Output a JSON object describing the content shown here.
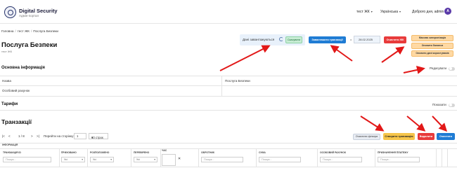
{
  "app": {
    "title": "Digital Security",
    "subtitle": "Адмін-портал"
  },
  "header": {
    "selected_zhk": "тест ЖК",
    "language": "Українська",
    "greeting": "Доброго дня, admin",
    "avatar_letter": "A"
  },
  "breadcrumb": [
    "Головна",
    "тест ЖК",
    "Послуга Безпеки"
  ],
  "page": {
    "title": "Послуга Безпеки",
    "subtitle": "тест ЖК"
  },
  "loading": {
    "text": "Дані завантажуються",
    "cancel_label": "Скасувати"
  },
  "toolbar": {
    "load_transactions_label": "Завантажити транзакції",
    "from_label": "з",
    "date_value": "28.02.2025",
    "clear_zhk_label": "Очистити ЖК"
  },
  "mass_actions": {
    "mass_sync_label": "Масова синхронізація",
    "update_balances_label": "Оновити баланси",
    "update_users_label": "Оновити дані користувачів"
  },
  "basic_info": {
    "title": "Основна інформація",
    "edit_label": "Редагувати",
    "edit_toggle_on": false,
    "rows": [
      {
        "label": "Назва",
        "value": "Послуга Безпеки"
      },
      {
        "label": "Особовий рахунок",
        "value": ""
      }
    ]
  },
  "tariffs": {
    "title": "Тарифи",
    "show_label": "Показати",
    "show_toggle_on": false
  },
  "transactions": {
    "title": "Транзакції",
    "pager": {
      "first": "|<",
      "prev": "<",
      "page_display": "1 / 8",
      "next": ">",
      "last": ">|",
      "goto_label": "Перейти на сторінку:",
      "goto_value": "1",
      "page_size": "10 строк"
    },
    "reset_filters_label": "Очистити фільтри",
    "create_label": "Створити транзакцію",
    "delete_label": "Видалити",
    "clear_label": "Очистити",
    "group_header": "ІНФОРМАЦІЯ",
    "columns": [
      {
        "label": "ТРАНЗАКЦІЯ ID",
        "filter": "Пошук...",
        "kind": "input"
      },
      {
        "label": "ПРИХОВАНО",
        "filter": "Усі",
        "kind": "select"
      },
      {
        "label": "РОЗПОЛОЖЕНО",
        "filter": "Усі",
        "kind": "select"
      },
      {
        "label": "ПЕРЕВІРЕНО",
        "filter": "Усі",
        "kind": "select"
      },
      {
        "label": "ЧАС",
        "filter": "",
        "kind": "date"
      },
      {
        "label": "ОБРОТНИК",
        "filter": "Пошук...",
        "kind": "input"
      },
      {
        "label": "СУМА",
        "filter": "Пошук...",
        "kind": "input"
      },
      {
        "label": "ОСОБОВИЙ РАХУНОК",
        "filter": "Пошук...",
        "kind": "input"
      },
      {
        "label": "ПРИЗНАЧЕННЯ ПЛАТЕЖУ",
        "filter": "Пошук...",
        "kind": "input"
      }
    ]
  },
  "colors": {
    "primary_blue": "#1f7cd4",
    "danger_red": "#e83b3b",
    "warning_yellow": "#f6c54a",
    "mass_orange": "#ffd9a3",
    "success_green": "#c7ecd4",
    "annotation_arrow": "#e21818"
  }
}
